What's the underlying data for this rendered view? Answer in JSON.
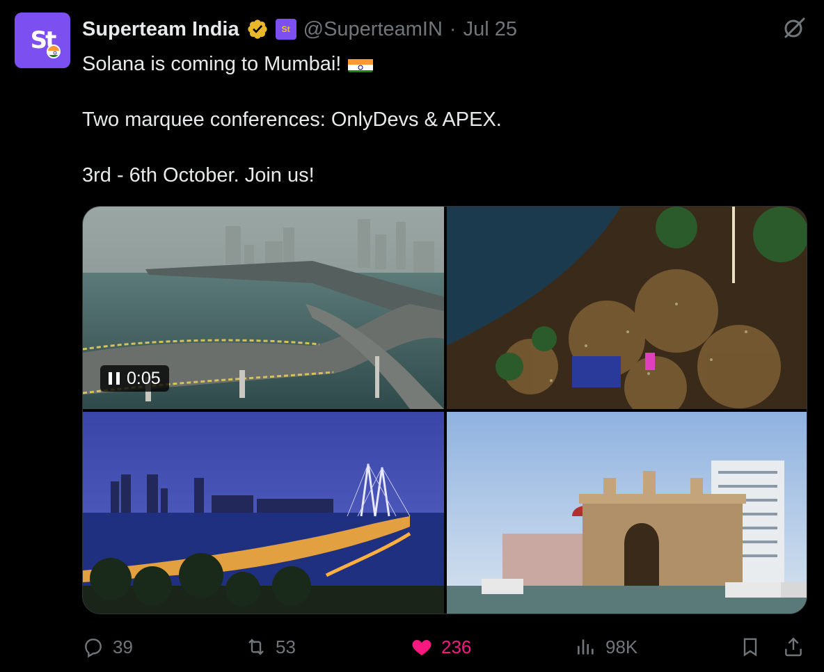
{
  "tweet": {
    "author_name": "Superteam India",
    "handle": "@SuperteamIN",
    "separator": "·",
    "date": "Jul 25",
    "avatar_text": "St",
    "affiliate_badge_text": "St",
    "text_lines": [
      "Solana is coming to Mumbai!",
      "Two marquee conferences: OnlyDevs & APEX.",
      "3rd - 6th October. Join us!"
    ],
    "flag_emoji": "india-flag-icon",
    "media": {
      "video_duration": "0:05",
      "tiles": [
        "mumbai-coastal-road-video",
        "mumbai-crowd-marine-drive",
        "bandra-worli-sea-link-night",
        "gateway-of-india"
      ]
    },
    "metrics": {
      "replies": "39",
      "reposts": "53",
      "likes": "236",
      "views": "98K"
    }
  },
  "colors": {
    "background": "#000000",
    "text": "#e7e9ea",
    "muted": "#71767b",
    "like": "#f91880",
    "avatar": "#7b4ff0",
    "verified": "#e8b829"
  }
}
